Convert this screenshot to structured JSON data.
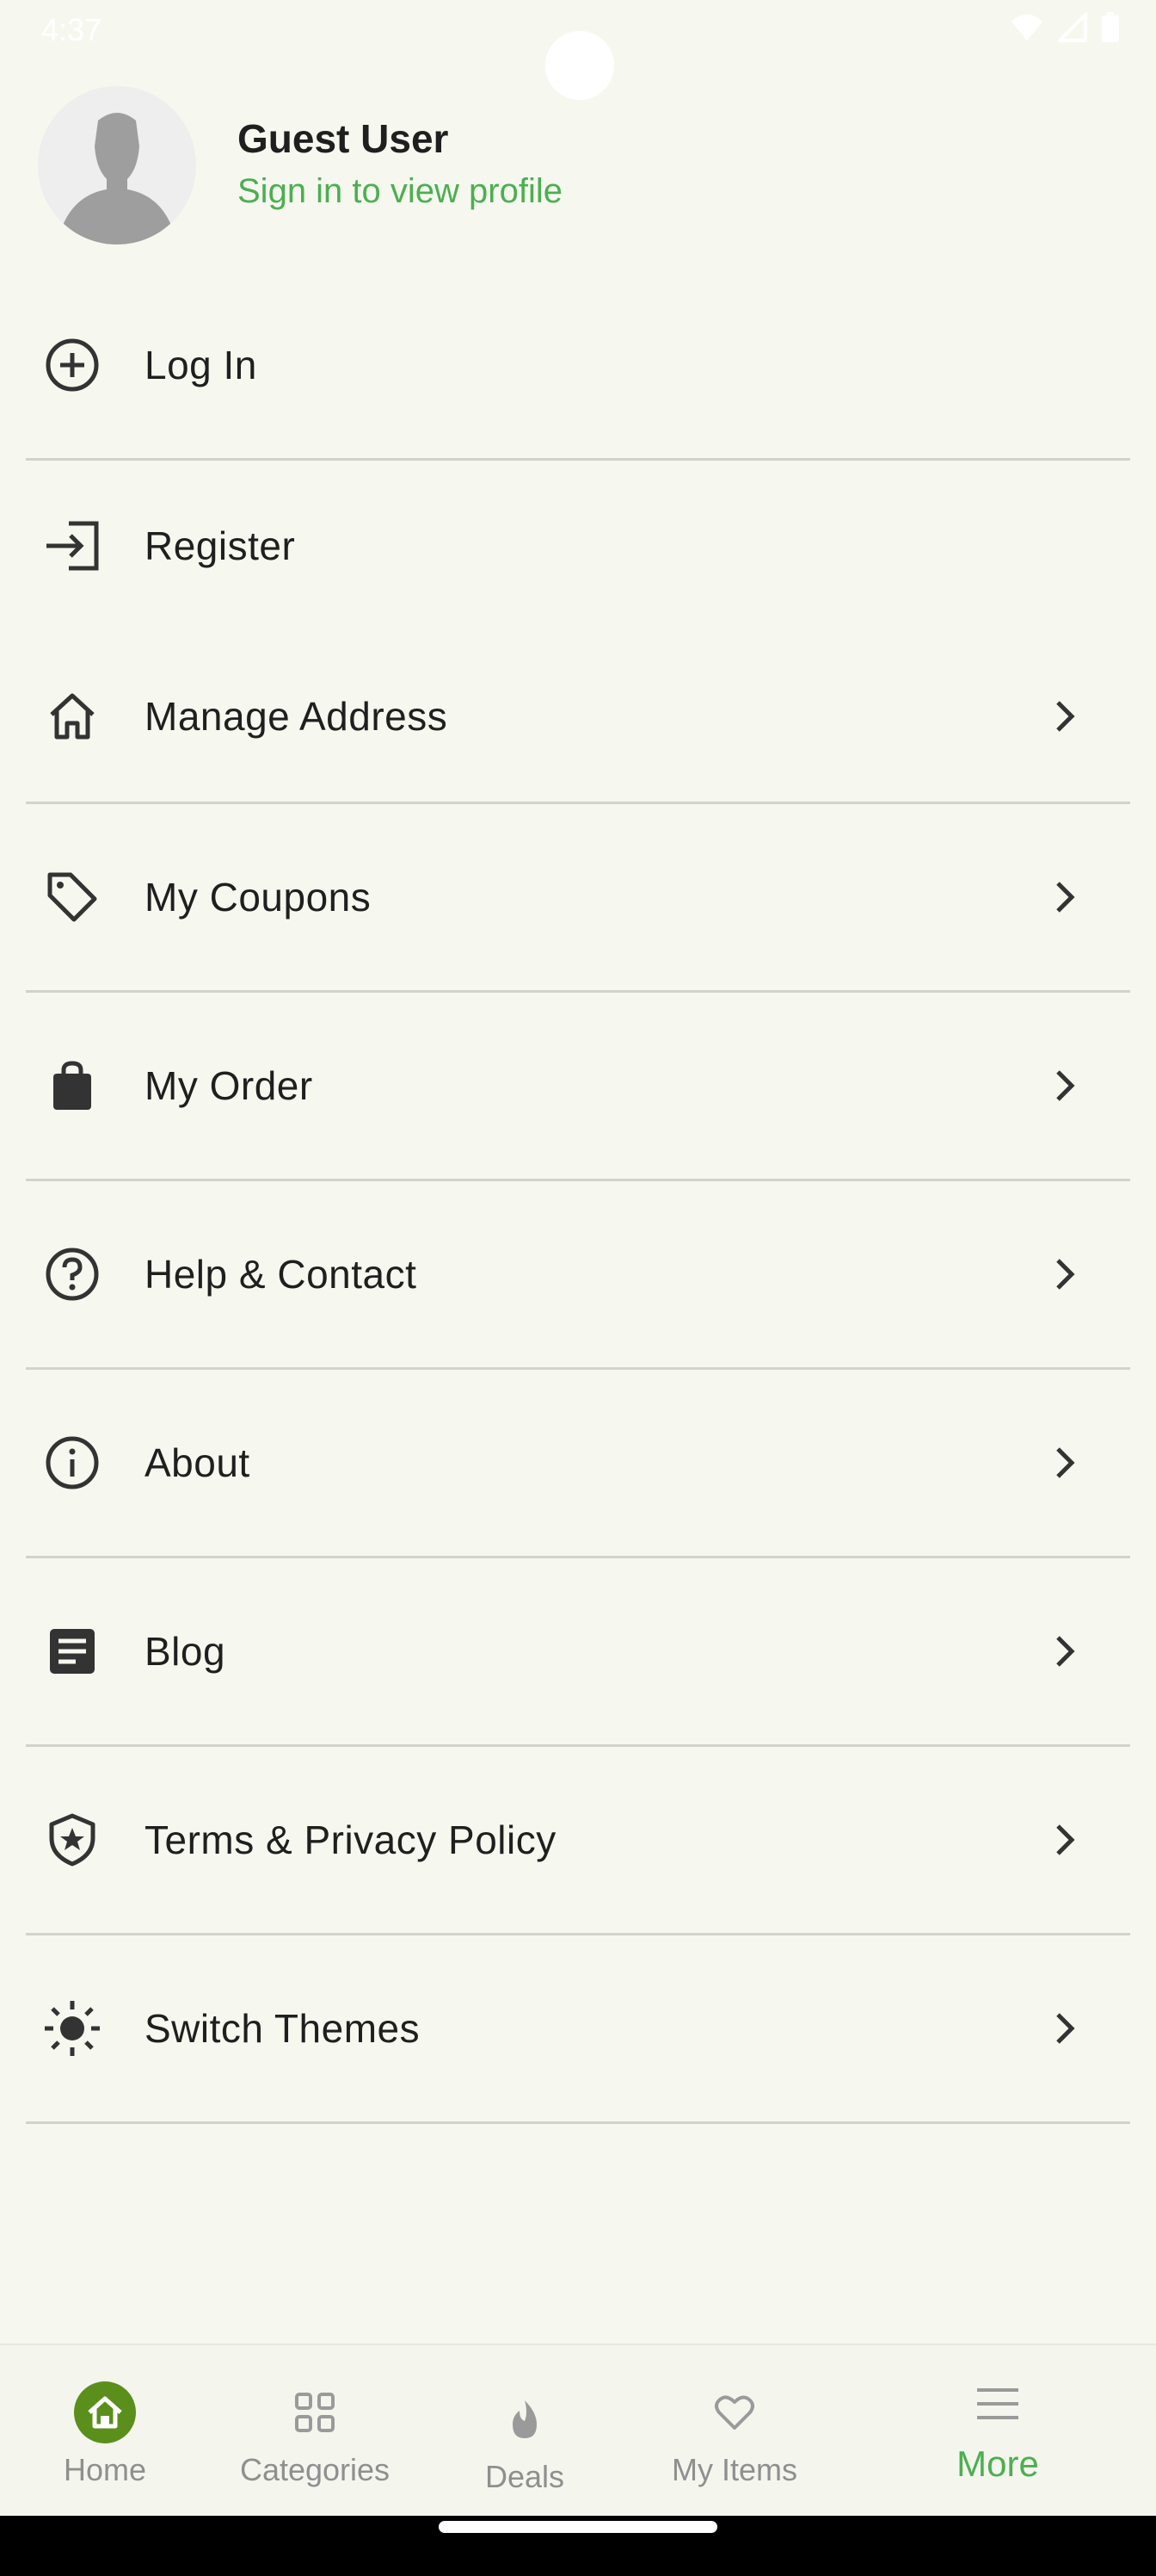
{
  "status_bar": {
    "time": "4:37"
  },
  "profile": {
    "name": "Guest User",
    "subtitle": "Sign in to view profile",
    "subtitle_color": "#4caf50"
  },
  "menu": {
    "items": [
      {
        "label": "Log In",
        "icon": "plus-circle-icon",
        "chevron": false
      },
      {
        "label": "Register",
        "icon": "login-arrow-icon",
        "chevron": false
      },
      {
        "label": "Manage Address",
        "icon": "home-outline-icon",
        "chevron": true
      },
      {
        "label": "My Coupons",
        "icon": "tag-icon",
        "chevron": true
      },
      {
        "label": "My Order",
        "icon": "shopping-bag-icon",
        "chevron": true
      },
      {
        "label": "Help & Contact",
        "icon": "help-circle-icon",
        "chevron": true
      },
      {
        "label": "About",
        "icon": "info-circle-icon",
        "chevron": true
      },
      {
        "label": "Blog",
        "icon": "article-icon",
        "chevron": true
      },
      {
        "label": "Terms & Privacy Policy",
        "icon": "shield-star-icon",
        "chevron": true
      },
      {
        "label": "Switch Themes",
        "icon": "sun-icon",
        "chevron": true
      }
    ]
  },
  "bottom_nav": {
    "items": [
      {
        "label": "Home",
        "icon": "home-icon",
        "active": false
      },
      {
        "label": "Categories",
        "icon": "grid-icon",
        "active": false
      },
      {
        "label": "Deals",
        "icon": "flame-icon",
        "active": false
      },
      {
        "label": "My Items",
        "icon": "heart-icon",
        "active": false
      },
      {
        "label": "More",
        "icon": "menu-icon",
        "active": true
      }
    ],
    "active_color": "#4caf50",
    "home_badge_color": "#5a8f1c"
  }
}
